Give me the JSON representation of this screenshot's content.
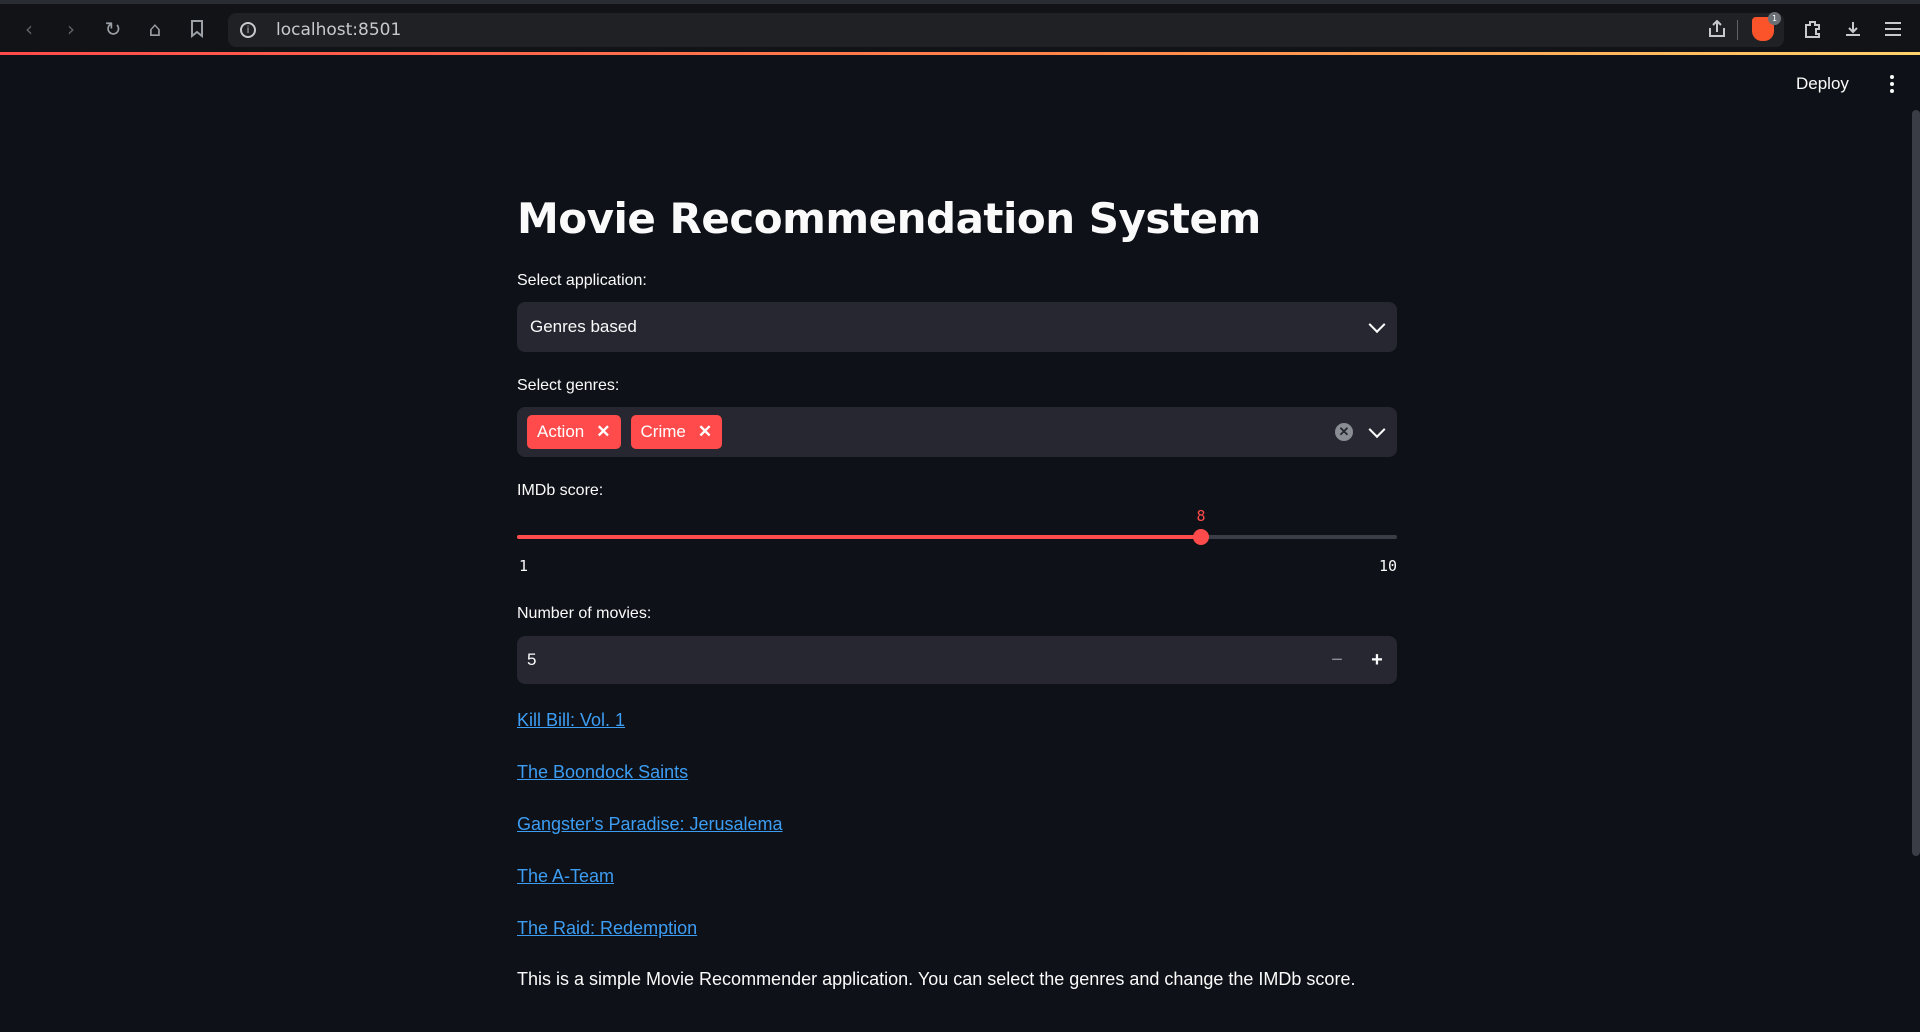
{
  "browser": {
    "url": "localhost:8501",
    "extension_badge": "1"
  },
  "header": {
    "deploy_label": "Deploy"
  },
  "app": {
    "title": "Movie Recommendation System",
    "application_label": "Select application:",
    "application_value": "Genres based",
    "genres_label": "Select genres:",
    "genres": [
      "Action",
      "Crime"
    ],
    "imdb_label": "IMDb score:",
    "imdb_value": 8,
    "imdb_min": 1,
    "imdb_max": 10,
    "movies_label": "Number of movies:",
    "movies_value": "5",
    "movies": [
      "Kill Bill: Vol. 1",
      "The Boondock Saints",
      "Gangster's Paradise: Jerusalema",
      "The A-Team",
      "The Raid: Redemption"
    ],
    "footer": "This is a simple Movie Recommender application. You can select the genres and change the IMDb score."
  },
  "colors": {
    "accent": "#ff4b4b",
    "background": "#0e1117",
    "widget_bg": "#262730",
    "link": "#3d9df3"
  }
}
